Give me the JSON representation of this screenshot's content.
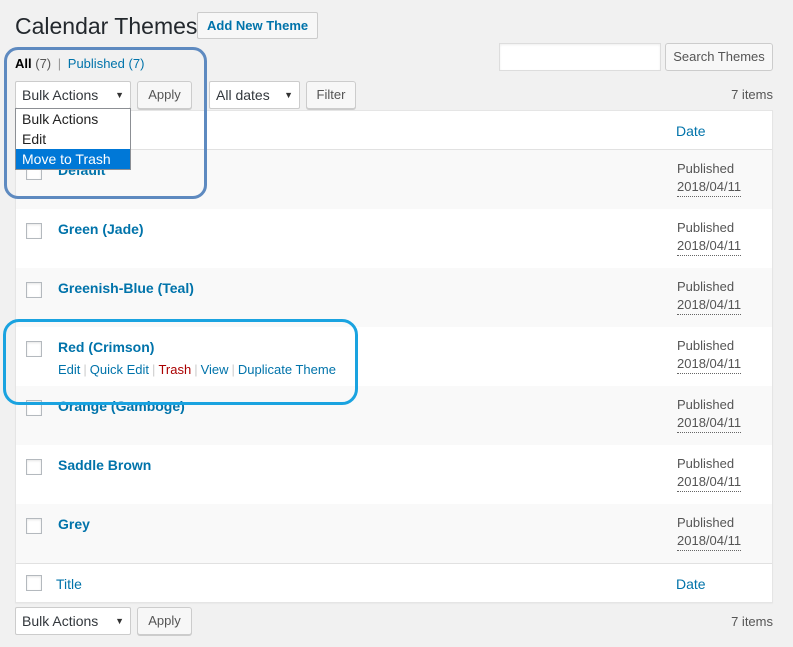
{
  "page": {
    "title": "Calendar Themes",
    "add_new_label": "Add New Theme"
  },
  "views": {
    "all_label": "All",
    "all_count": "(7)",
    "separator": "|",
    "published_label": "Published",
    "published_count": "(7)"
  },
  "search": {
    "placeholder": "",
    "button_label": "Search Themes"
  },
  "top_nav": {
    "bulk_actions": "Bulk Actions",
    "apply": "Apply",
    "dates": "All dates",
    "filter": "Filter",
    "items": "7 items"
  },
  "bulk_dropdown": {
    "options": [
      "Bulk Actions",
      "Edit",
      "Move to Trash"
    ],
    "selected": "Move to Trash"
  },
  "table": {
    "header_title": "Title",
    "header_date": "Date",
    "rows": [
      {
        "title": "Default",
        "status": "Published",
        "date": "2018/04/11"
      },
      {
        "title": "Green (Jade)",
        "status": "Published",
        "date": "2018/04/11"
      },
      {
        "title": "Greenish-Blue (Teal)",
        "status": "Published",
        "date": "2018/04/11"
      },
      {
        "title": "Red (Crimson)",
        "status": "Published",
        "date": "2018/04/11"
      },
      {
        "title": "Orange (Gamboge)",
        "status": "Published",
        "date": "2018/04/11"
      },
      {
        "title": "Saddle Brown",
        "status": "Published",
        "date": "2018/04/11"
      },
      {
        "title": "Grey",
        "status": "Published",
        "date": "2018/04/11"
      }
    ],
    "row_actions": {
      "edit": "Edit",
      "quick_edit": "Quick Edit",
      "trash": "Trash",
      "view": "View",
      "duplicate": "Duplicate Theme",
      "separator": "|"
    }
  },
  "bottom_nav": {
    "bulk_actions": "Bulk Actions",
    "apply": "Apply",
    "items": "7 items"
  },
  "colors": {
    "link": "#0073aa",
    "highlight_dropdown": "#5e8ac0",
    "highlight_row": "#1aa3e0",
    "trash": "#aa0000",
    "selected_option": "#0078d7"
  }
}
